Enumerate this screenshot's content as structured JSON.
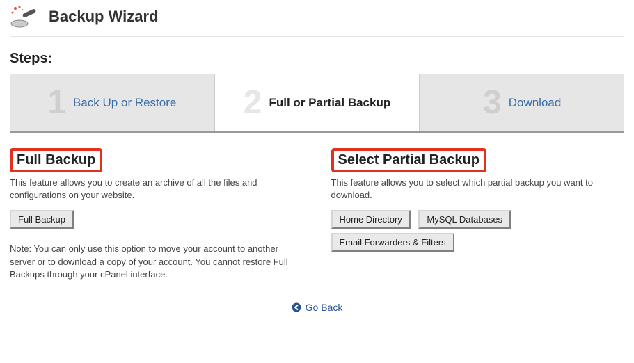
{
  "header": {
    "title": "Backup Wizard",
    "icon": "backup-wizard-icon"
  },
  "steps_title": "Steps:",
  "steps": [
    {
      "number": "1",
      "label": "Back Up or Restore",
      "active": false
    },
    {
      "number": "2",
      "label": "Full or Partial Backup",
      "active": true
    },
    {
      "number": "3",
      "label": "Download",
      "active": false
    }
  ],
  "full_backup": {
    "title": "Full Backup",
    "description": "This feature allows you to create an archive of all the files and configurations on your website.",
    "button": "Full Backup",
    "note": "Note: You can only use this option to move your account to another server or to download a copy of your account. You cannot restore Full Backups through your cPanel interface."
  },
  "partial_backup": {
    "title": "Select Partial Backup",
    "description": "This feature allows you to select which partial backup you want to download.",
    "buttons": [
      "Home Directory",
      "MySQL Databases",
      "Email Forwarders & Filters"
    ]
  },
  "go_back": {
    "label": "Go Back"
  }
}
